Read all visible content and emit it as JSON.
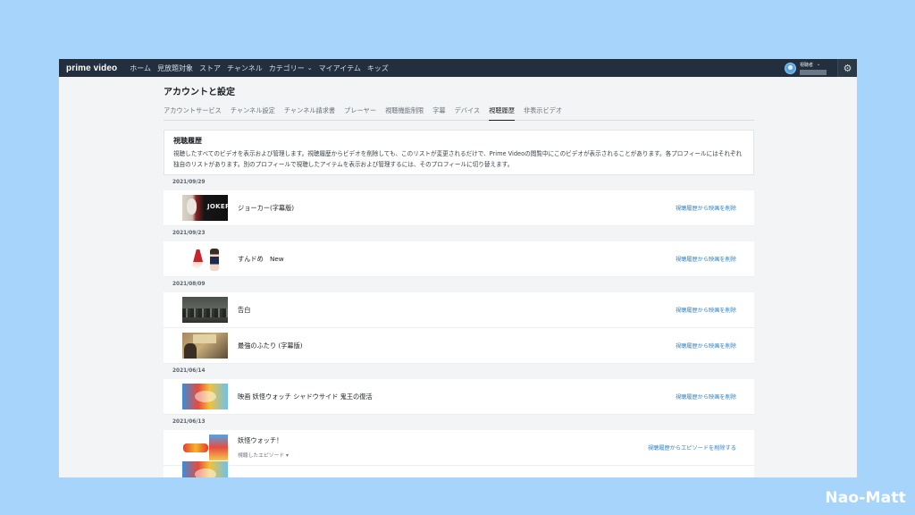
{
  "nav": {
    "logo": "prime video",
    "items": [
      "ホーム",
      "見放題対象",
      "ストア",
      "チャンネル",
      "カテゴリー",
      "マイアイテム",
      "キッズ"
    ],
    "profile_name": "視聴者",
    "settings_icon": "gear-icon"
  },
  "page": {
    "title": "アカウントと設定",
    "tabs": [
      "アカウントサービス",
      "チャンネル設定",
      "チャンネル請求書",
      "プレーヤー",
      "視聴機能制限",
      "字幕",
      "デバイス",
      "視聴履歴",
      "非表示ビデオ"
    ],
    "active_tab": "視聴履歴"
  },
  "history": {
    "heading": "視聴履歴",
    "description": "視聴したすべてのビデオを表示および管理します。視聴履歴からビデオを削除しても、このリストが変更されるだけで、Prime Videoの閲覧中にこのビデオが表示されることがあります。各プロフィールにはそれぞれ独自のリストがあります。別のプロフィールで視聴したアイテムを表示および管理するには、そのプロフィールに切り替えます。",
    "groups": [
      {
        "date": "2021/09/29",
        "items": [
          {
            "title": "ジョーカー(字幕版)",
            "action": "視聴履歴から映画を削除"
          }
        ]
      },
      {
        "date": "2021/09/23",
        "items": [
          {
            "title": "すんドめ　New",
            "action": "視聴履歴から映画を削除"
          }
        ]
      },
      {
        "date": "2021/08/09",
        "items": [
          {
            "title": "告白",
            "action": "視聴履歴から映画を削除"
          },
          {
            "title": "最強のふたり (字幕版)",
            "action": "視聴履歴から映画を削除"
          }
        ]
      },
      {
        "date": "2021/06/14",
        "items": [
          {
            "title": "映画 妖怪ウォッチ シャドウサイド 鬼王の復活",
            "action": "視聴履歴から映画を削除"
          }
        ]
      },
      {
        "date": "2021/06/13",
        "items": [
          {
            "title": "妖怪ウォッチ！",
            "subtitle": "視聴したエピソード",
            "action": "視聴履歴からエピソードを削除する"
          }
        ]
      }
    ]
  },
  "watermark": "Nao-Matt"
}
